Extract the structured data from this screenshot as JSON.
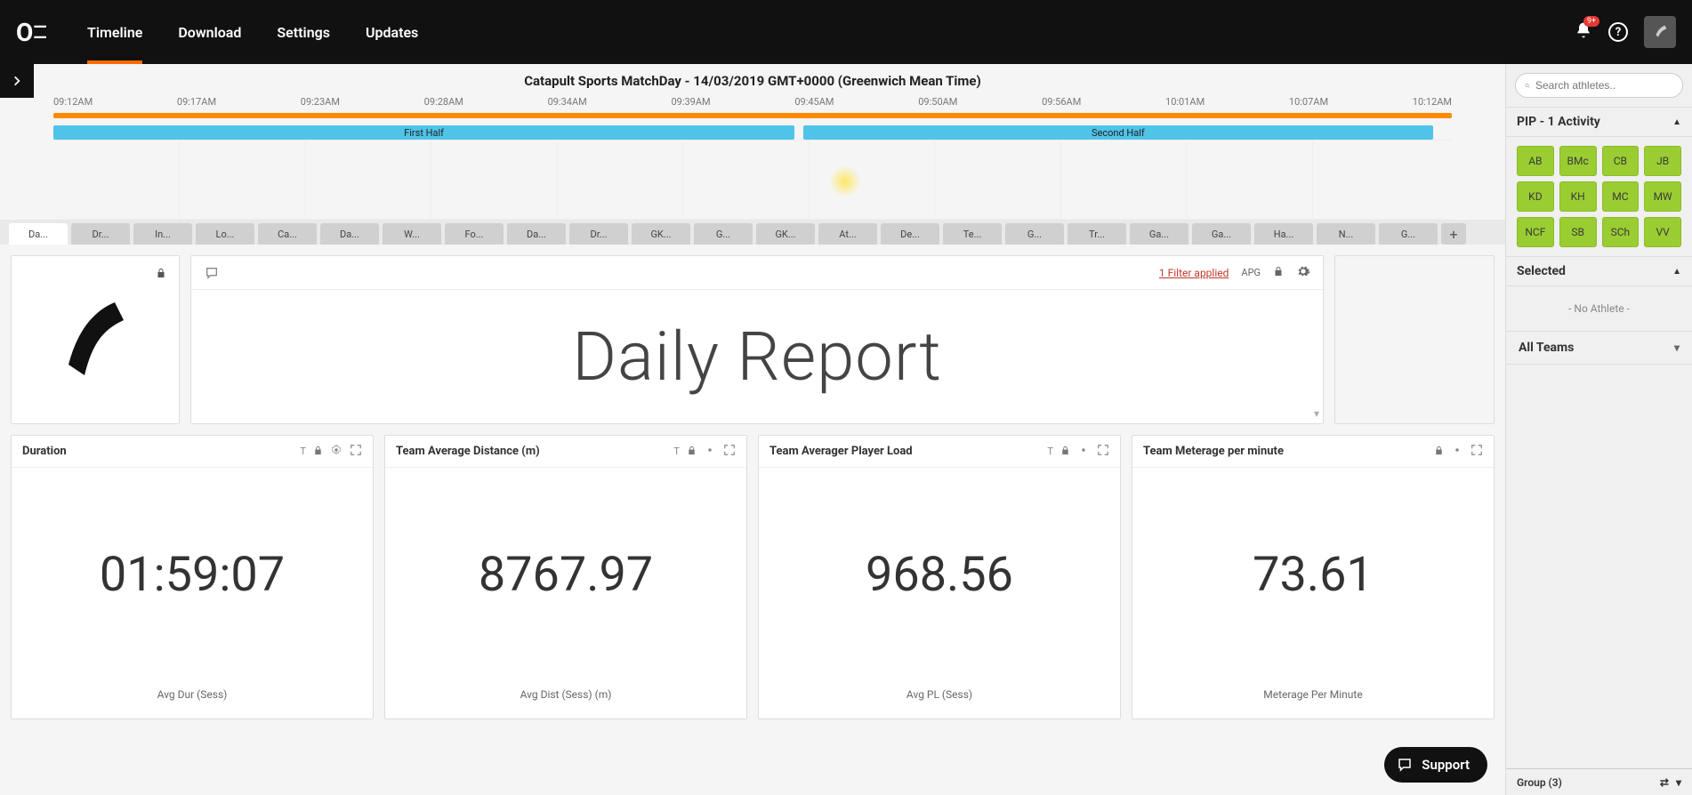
{
  "nav": {
    "items": [
      "Timeline",
      "Download",
      "Settings",
      "Updates"
    ],
    "active": 0,
    "notification_badge": "9+"
  },
  "timeline": {
    "title": "Catapult Sports MatchDay - 14/03/2019 GMT+0000 (Greenwich Mean Time)",
    "ticks": [
      "09:12AM",
      "09:17AM",
      "09:23AM",
      "09:28AM",
      "09:34AM",
      "09:39AM",
      "09:45AM",
      "09:50AM",
      "09:56AM",
      "10:01AM",
      "10:07AM",
      "10:12AM"
    ],
    "segments": [
      {
        "label": "First Half"
      },
      {
        "label": "Second Half"
      }
    ]
  },
  "tabs": [
    "Da...",
    "Dr...",
    "In...",
    "Lo...",
    "Ca...",
    "Da...",
    "W...",
    "Fo...",
    "Da...",
    "Dr...",
    "GK...",
    "G...",
    "GK...",
    "At...",
    "De...",
    "Te...",
    "G...",
    "Tr...",
    "Ga...",
    "Ga...",
    "Ha...",
    "N...",
    "G..."
  ],
  "report": {
    "filter_text": "1 Filter applied",
    "apg": "APG",
    "title": "Daily Report"
  },
  "metrics": [
    {
      "title": "Duration",
      "value": "01:59:07",
      "footer": "Avg Dur (Sess)"
    },
    {
      "title": "Team Average Distance (m)",
      "value": "8767.97",
      "footer": "Avg Dist (Sess) (m)"
    },
    {
      "title": "Team Averager Player Load",
      "value": "968.56",
      "footer": "Avg PL (Sess)"
    },
    {
      "title": "Team Meterage per minute",
      "value": "73.61",
      "footer": "Meterage Per Minute"
    }
  ],
  "right": {
    "search_placeholder": "Search athletes..",
    "activity_title": "PIP - 1 Activity",
    "athletes": [
      "AB",
      "BMc",
      "CB",
      "JB",
      "KD",
      "KH",
      "MC",
      "MW",
      "NCF",
      "SB",
      "SCh",
      "VV"
    ],
    "selected_title": "Selected",
    "no_athlete": "- No Athlete -",
    "teams_label": "All Teams",
    "group_label": "Group (3)"
  },
  "support_label": "Support"
}
